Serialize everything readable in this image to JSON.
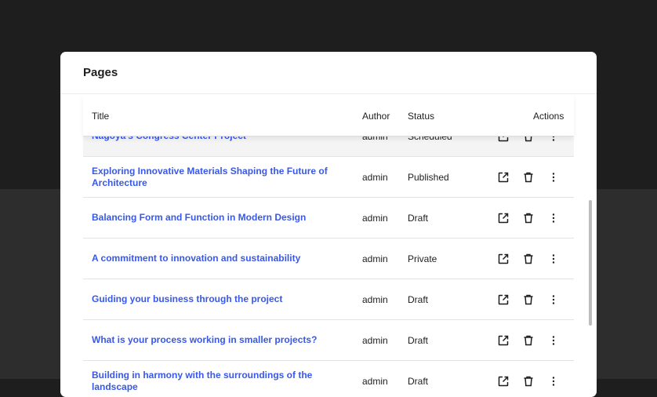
{
  "panel": {
    "title": "Pages"
  },
  "columns": {
    "title": "Title",
    "author": "Author",
    "status": "Status",
    "actions": "Actions"
  },
  "rows": [
    {
      "title": "Nagoya's Congress Center Project",
      "author": "admin",
      "status": "Scheduled"
    },
    {
      "title": "Exploring Innovative Materials Shaping the Future of Architecture",
      "author": "admin",
      "status": "Published"
    },
    {
      "title": "Balancing Form and Function in Modern Design",
      "author": "admin",
      "status": "Draft"
    },
    {
      "title": "A commitment to innovation and sustainability",
      "author": "admin",
      "status": "Private"
    },
    {
      "title": "Guiding your business through the project",
      "author": "admin",
      "status": "Draft"
    },
    {
      "title": "What is your process working in smaller projects?",
      "author": "admin",
      "status": "Draft"
    },
    {
      "title": "Building in harmony with the surroundings of the landscape",
      "author": "admin",
      "status": "Draft"
    }
  ],
  "row_actions": [
    "external-link-icon",
    "trash-icon",
    "more-vertical-icon"
  ],
  "colors": {
    "link": "#3858e9",
    "text": "#1e1e1e",
    "background": "#1e1e1e",
    "panel": "#ffffff"
  }
}
